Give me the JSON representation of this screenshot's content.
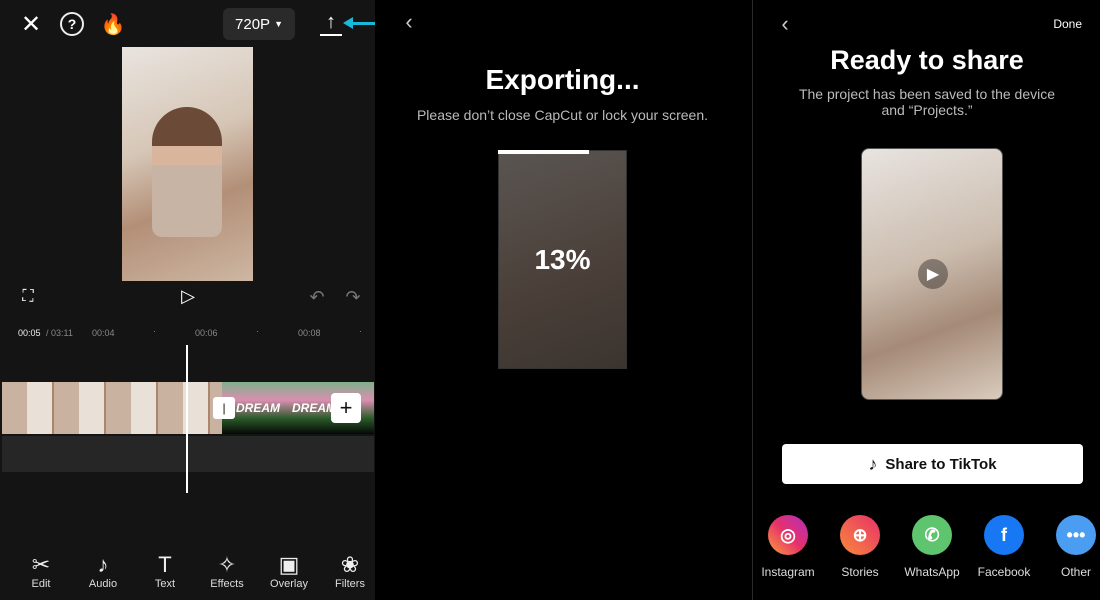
{
  "editor": {
    "resolution": "720P",
    "time_current": "00:05",
    "time_total": "/ 03:11",
    "ticks": [
      "00:04",
      "00:06",
      "00:08"
    ],
    "clip_text": "DREAM",
    "tools": [
      {
        "label": "Edit",
        "icon": "scissors-icon",
        "glyph": "✂"
      },
      {
        "label": "Audio",
        "icon": "music-note-icon",
        "glyph": "♪"
      },
      {
        "label": "Text",
        "icon": "text-icon",
        "glyph": "T"
      },
      {
        "label": "Effects",
        "icon": "effects-star-icon",
        "glyph": "✧"
      },
      {
        "label": "Overlay",
        "icon": "overlay-icon",
        "glyph": "▣"
      },
      {
        "label": "Filters",
        "icon": "filters-icon",
        "glyph": "❀"
      }
    ]
  },
  "exporting": {
    "title": "Exporting...",
    "subtitle": "Please don’t close CapCut or lock your screen.",
    "progress_percent": 13,
    "progress_label": "13%"
  },
  "share": {
    "done": "Done",
    "title": "Ready to share",
    "subtitle": "The project has been saved to the device and “Projects.”",
    "tiktok_label": "Share to TikTok",
    "targets": [
      {
        "label": "Instagram",
        "icon": "instagram-icon",
        "glyph": "◎",
        "color": "linear-gradient(45deg,#f9a23a,#e7306a,#b02fc2)"
      },
      {
        "label": "Stories",
        "icon": "stories-icon",
        "glyph": "⊕",
        "color": "linear-gradient(45deg,#f98a3a,#e7306a)"
      },
      {
        "label": "WhatsApp",
        "icon": "whatsapp-icon",
        "glyph": "✆",
        "color": "#5fc46e"
      },
      {
        "label": "Facebook",
        "icon": "facebook-icon",
        "glyph": "f",
        "color": "#1877f2"
      },
      {
        "label": "Other",
        "icon": "more-icon",
        "glyph": "•••",
        "color": "#4a9df0"
      }
    ]
  },
  "colors": {
    "arrow_annotation": "#1ab8d8"
  }
}
